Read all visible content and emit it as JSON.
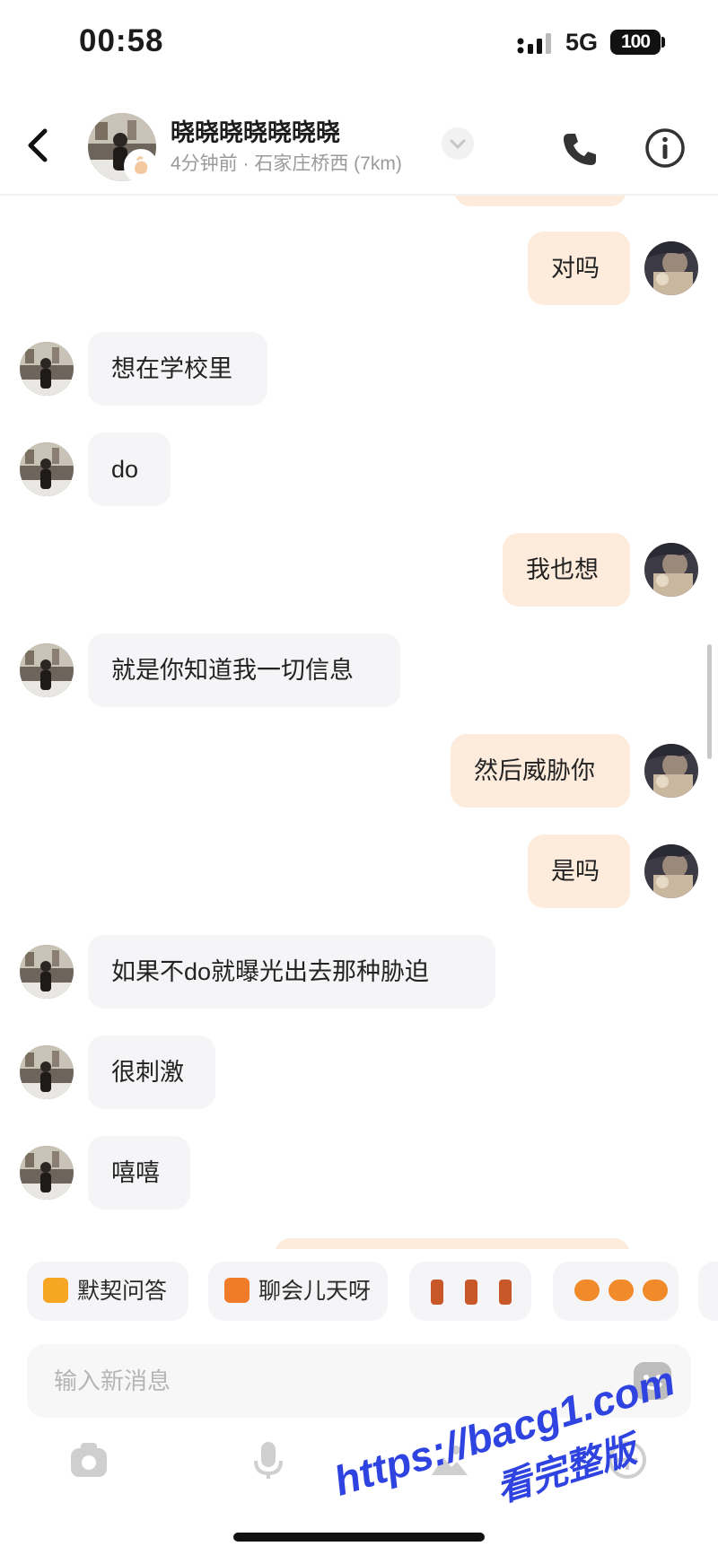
{
  "status_bar": {
    "time": "00:58",
    "network": "5G",
    "battery": "100"
  },
  "header": {
    "contact_name": "晓晓晓晓晓晓晓",
    "subtitle": "4分钟前 · 石家庄桥西 (7km)",
    "icons": {
      "back": "chevron-left-icon",
      "call": "phone-icon",
      "info": "info-icon",
      "dropdown": "chevron-down-icon"
    }
  },
  "messages": [
    {
      "side": "out",
      "text": "对吗"
    },
    {
      "side": "in",
      "text": "想在学校里"
    },
    {
      "side": "in",
      "text": "do"
    },
    {
      "side": "out",
      "text": "我也想"
    },
    {
      "side": "in",
      "text": "就是你知道我一切信息"
    },
    {
      "side": "out",
      "text": "然后威胁你"
    },
    {
      "side": "out",
      "text": "是吗"
    },
    {
      "side": "in",
      "text": "如果不do就曝光出去那种胁迫"
    },
    {
      "side": "in",
      "text": "很刺激"
    },
    {
      "side": "in",
      "text": "嘻嘻"
    }
  ],
  "quick_replies": [
    {
      "label": "默契问答",
      "icon": "pencil-note-icon",
      "color": "#f6a623"
    },
    {
      "label": "聊会儿天呀",
      "icon": "chat-face-icon",
      "color": "#f07c2a"
    },
    {
      "label": "",
      "icon": "socks-sticker-icon",
      "color": "#c8572a"
    },
    {
      "label": "",
      "icon": "cat-sticker-icon",
      "color": "#f08a2a"
    }
  ],
  "composer": {
    "placeholder": "输入新消息",
    "tools": [
      "camera-icon",
      "microphone-icon",
      "image-icon",
      "plus-circle-icon"
    ]
  },
  "watermark": {
    "line1": "https://bacg1.com",
    "line2": "看完整版"
  },
  "colors": {
    "outgoing_bubble": "#fdebdc",
    "incoming_bubble": "#f5f5f7",
    "watermark": "#2f43e0"
  }
}
